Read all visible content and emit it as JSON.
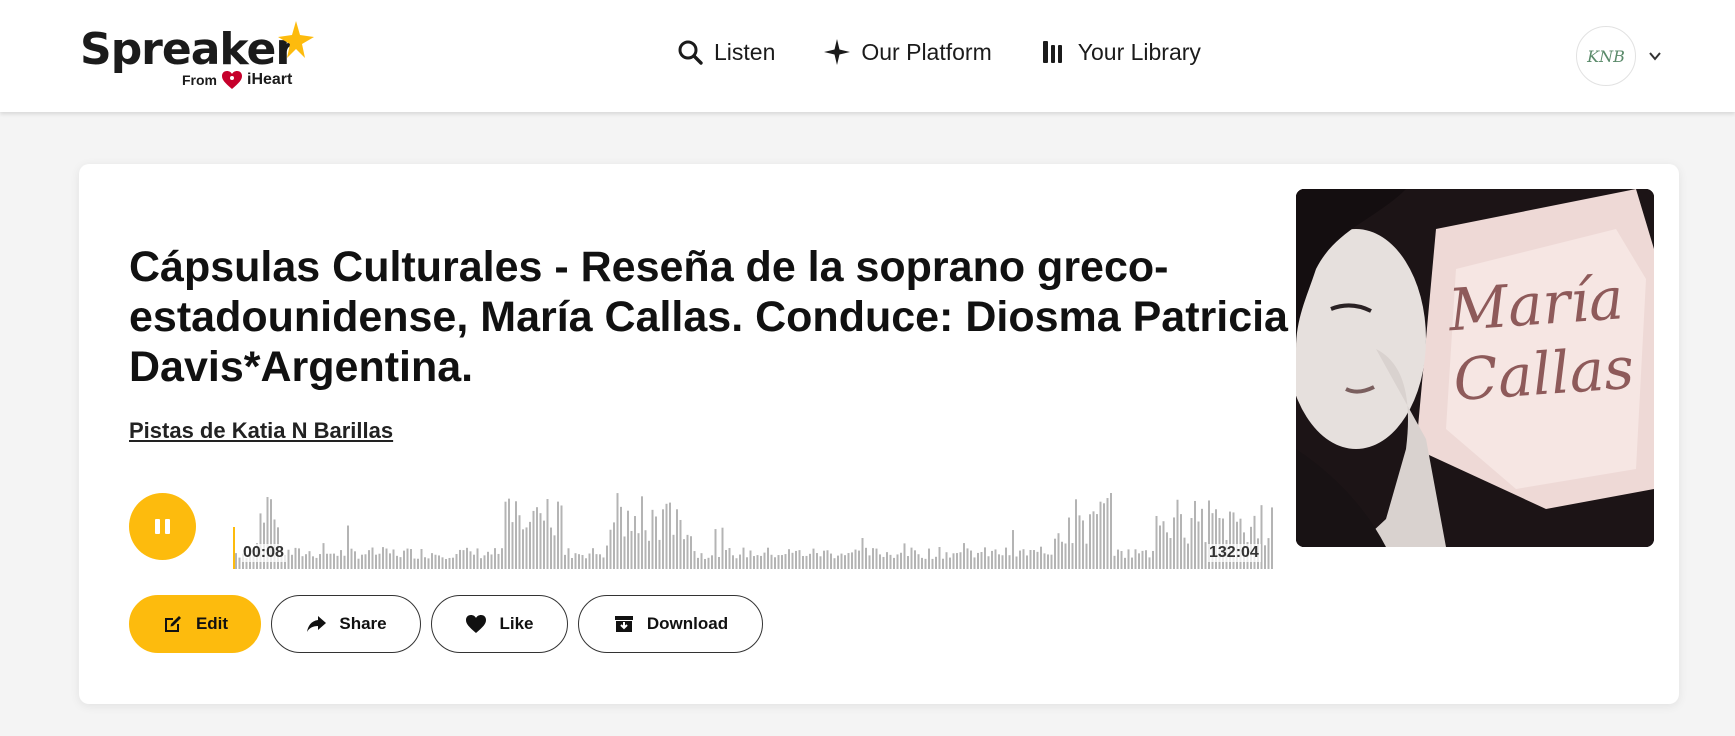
{
  "header": {
    "logo": {
      "word": "Spreaker",
      "from": "From",
      "partner": "iHeart"
    },
    "nav": [
      {
        "label": "Listen",
        "icon": "search-icon"
      },
      {
        "label": "Our Platform",
        "icon": "sparkle-icon"
      },
      {
        "label": "Your Library",
        "icon": "library-icon"
      }
    ],
    "avatar": {
      "initials": "KNB"
    }
  },
  "episode": {
    "title": "Cápsulas Culturales - Reseña de la soprano greco-estadounidense, María Callas. Conduce: Diosma Patricia Davis*Argentina.",
    "author": "Pistas de Katia N Barillas",
    "player": {
      "state": "playing",
      "current_time": "00:08",
      "total_time": "132:04",
      "progress_fraction": 0.001
    },
    "cover": {
      "text_line1": "María",
      "text_line2": "Callas"
    }
  },
  "actions": {
    "edit_label": "Edit",
    "share_label": "Share",
    "like_label": "Like",
    "download_label": "Download"
  },
  "colors": {
    "accent": "#fdbb0d",
    "waveform": "#b4b4b4",
    "text": "#111111"
  }
}
